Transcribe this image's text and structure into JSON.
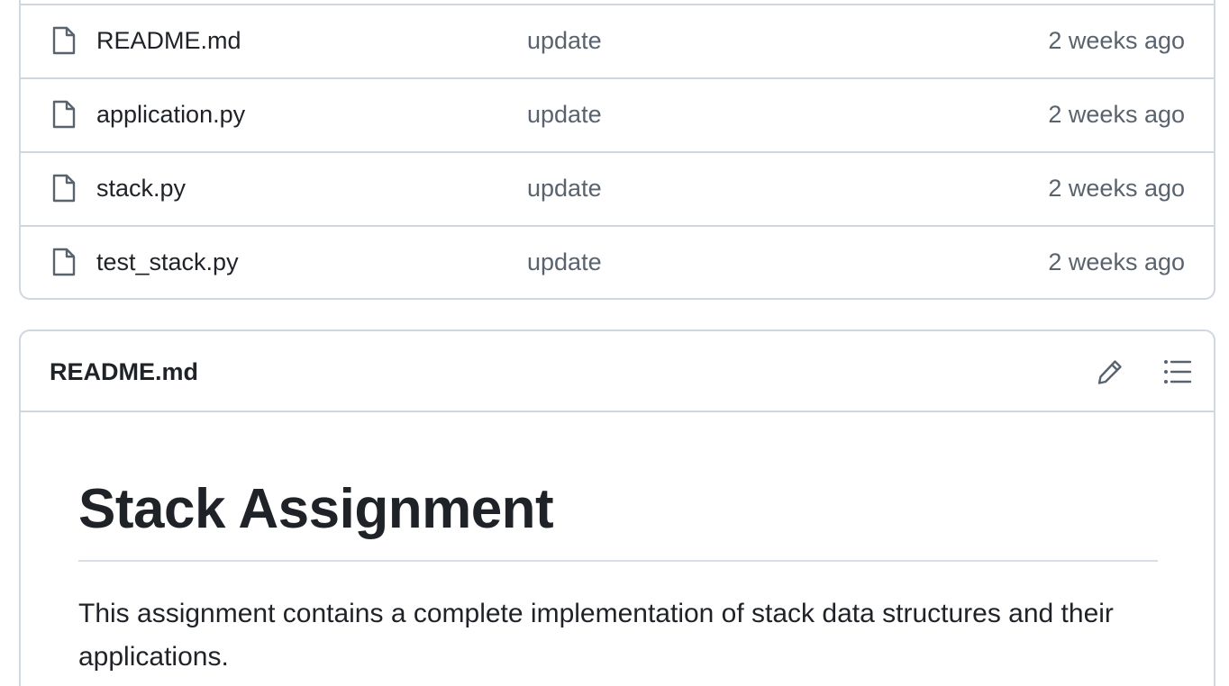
{
  "files": [
    {
      "name": "README.md",
      "commit": "update",
      "age": "2 weeks ago",
      "icon": "file-icon"
    },
    {
      "name": "application.py",
      "commit": "update",
      "age": "2 weeks ago",
      "icon": "file-icon"
    },
    {
      "name": "stack.py",
      "commit": "update",
      "age": "2 weeks ago",
      "icon": "file-icon"
    },
    {
      "name": "test_stack.py",
      "commit": "update",
      "age": "2 weeks ago",
      "icon": "file-icon"
    }
  ],
  "readme": {
    "title": "README.md",
    "edit_icon": "pencil-icon",
    "toc_icon": "list-unordered-icon",
    "heading": "Stack Assignment",
    "paragraph": "This assignment contains a complete implementation of stack data structures and their applications."
  },
  "colors": {
    "text": "#1f2328",
    "muted": "#59636e",
    "border": "#d0d7de"
  }
}
